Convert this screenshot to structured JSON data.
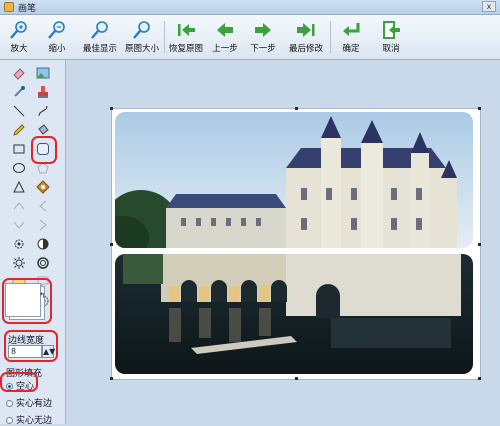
{
  "window": {
    "title": "画笔",
    "close_label": "x"
  },
  "toolbar": {
    "buttons": [
      {
        "label": "放大",
        "icon": "zoom-in-icon"
      },
      {
        "label": "缩小",
        "icon": "zoom-out-icon"
      },
      {
        "label": "最佳显示",
        "icon": "best-fit-icon"
      },
      {
        "label": "原图大小",
        "icon": "original-size-icon"
      },
      {
        "label": "恢复原图",
        "icon": "restore-icon"
      },
      {
        "label": "上一步",
        "icon": "undo-icon"
      },
      {
        "label": "下一步",
        "icon": "redo-icon"
      },
      {
        "label": "最后修改",
        "icon": "last-edit-icon"
      },
      {
        "label": "确定",
        "icon": "confirm-icon"
      },
      {
        "label": "取消",
        "icon": "cancel-icon"
      }
    ]
  },
  "panel": {
    "tools": [
      "eraser-icon",
      "picture-icon",
      "eyedropper-icon",
      "stamp-icon",
      "line-icon",
      "curve-icon",
      "pencil-icon",
      "fill-bucket-icon",
      "rectangle-icon",
      "rounded-rectangle-icon",
      "ellipse-icon",
      "polygon-icon",
      "triangle-icon",
      "diamond-icon",
      "arrow-up-icon",
      "arrow-left-icon",
      "arrow-right-icon",
      "arrow-down-icon",
      "gear-icon",
      "half-circle-icon",
      "sun-icon",
      "ring-icon",
      "rectangle-fill-icon",
      "callout-icon",
      "star-icon",
      "flower-icon"
    ],
    "selected_tool": "rounded-rectangle-icon",
    "border_width_label": "边线宽度",
    "border_width_value": "8",
    "spin_label": "▲▼",
    "fill_label": "图形填充",
    "fill_options": [
      {
        "label": "空心",
        "selected": true
      },
      {
        "label": "实心有边",
        "selected": false
      },
      {
        "label": "实心无边",
        "selected": false
      }
    ],
    "highlight_color": "#e3252b"
  }
}
